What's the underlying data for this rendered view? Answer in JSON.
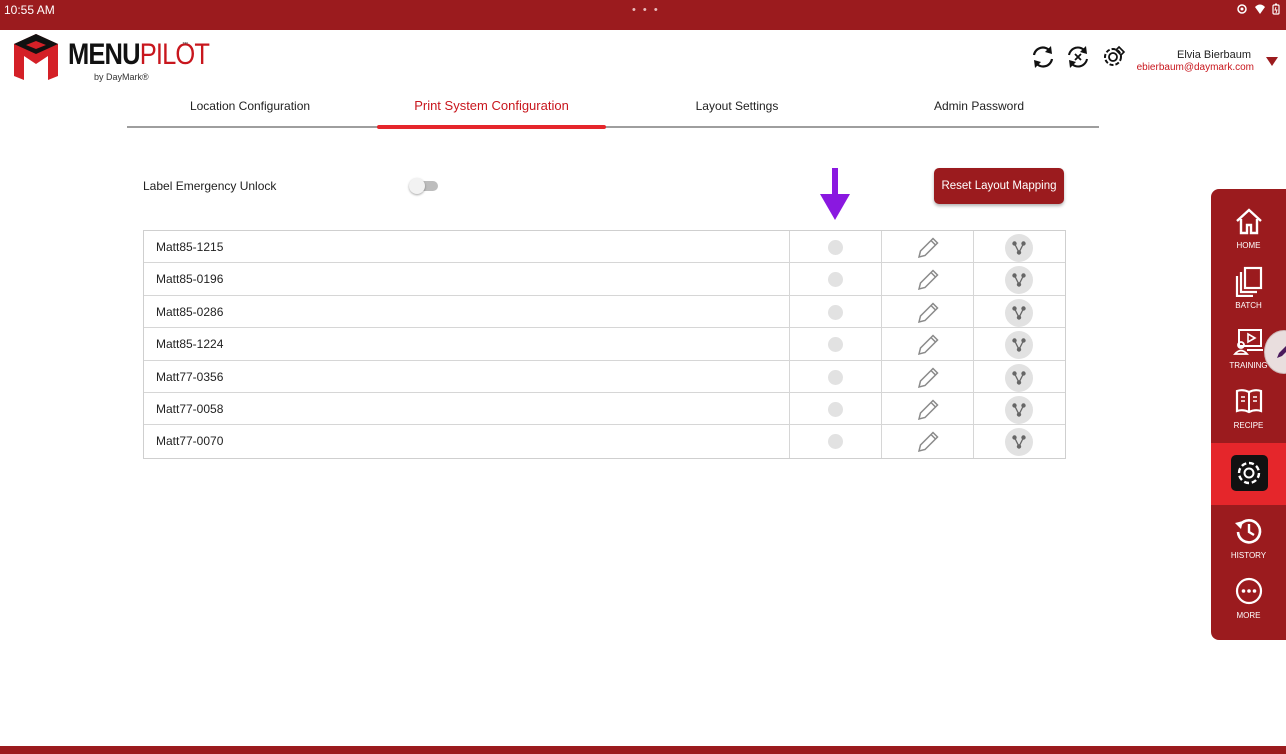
{
  "status_bar": {
    "time": "10:55 AM",
    "dots": "• • •",
    "icons": [
      "vpn-icon",
      "wifi-icon",
      "battery-icon"
    ]
  },
  "brand": {
    "menu": "MENU",
    "pilot": "PILOT",
    "tm": "™",
    "by": "by DayMark®"
  },
  "header": {
    "icons": [
      "sync-icon",
      "cancel-sync-icon",
      "gear-wrench-icon"
    ],
    "user_name": "Elvia Bierbaum",
    "user_email": "ebierbaum@daymark.com"
  },
  "tabs": [
    {
      "label": "Location Configuration",
      "active": false
    },
    {
      "label": "Print System Configuration",
      "active": true
    },
    {
      "label": "Layout Settings",
      "active": false
    },
    {
      "label": "Admin Password",
      "active": false
    }
  ],
  "emergency_unlock": {
    "label": "Label Emergency Unlock",
    "enabled": false
  },
  "reset_button": {
    "label": "Reset Layout Mapping"
  },
  "printers": [
    {
      "name": "Matt85-1215"
    },
    {
      "name": "Matt85-0196"
    },
    {
      "name": "Matt85-0286"
    },
    {
      "name": "Matt85-1224"
    },
    {
      "name": "Matt77-0356"
    },
    {
      "name": "Matt77-0058"
    },
    {
      "name": "Matt77-0070"
    }
  ],
  "sidenav": [
    {
      "label": "HOME",
      "icon": "home-icon"
    },
    {
      "label": "BATCH",
      "icon": "batch-icon"
    },
    {
      "label": "TRAINING",
      "icon": "training-icon"
    },
    {
      "label": "RECIPE",
      "icon": "recipe-book-icon"
    },
    {
      "label": "",
      "icon": "settings-gear-icon",
      "active": true
    },
    {
      "label": "HISTORY",
      "icon": "history-icon"
    },
    {
      "label": "MORE",
      "icon": "more-icon"
    }
  ],
  "colors": {
    "brand_dark": "#9b1b1e",
    "brand_red": "#e5262b",
    "annotation_arrow": "#8a18e0"
  }
}
